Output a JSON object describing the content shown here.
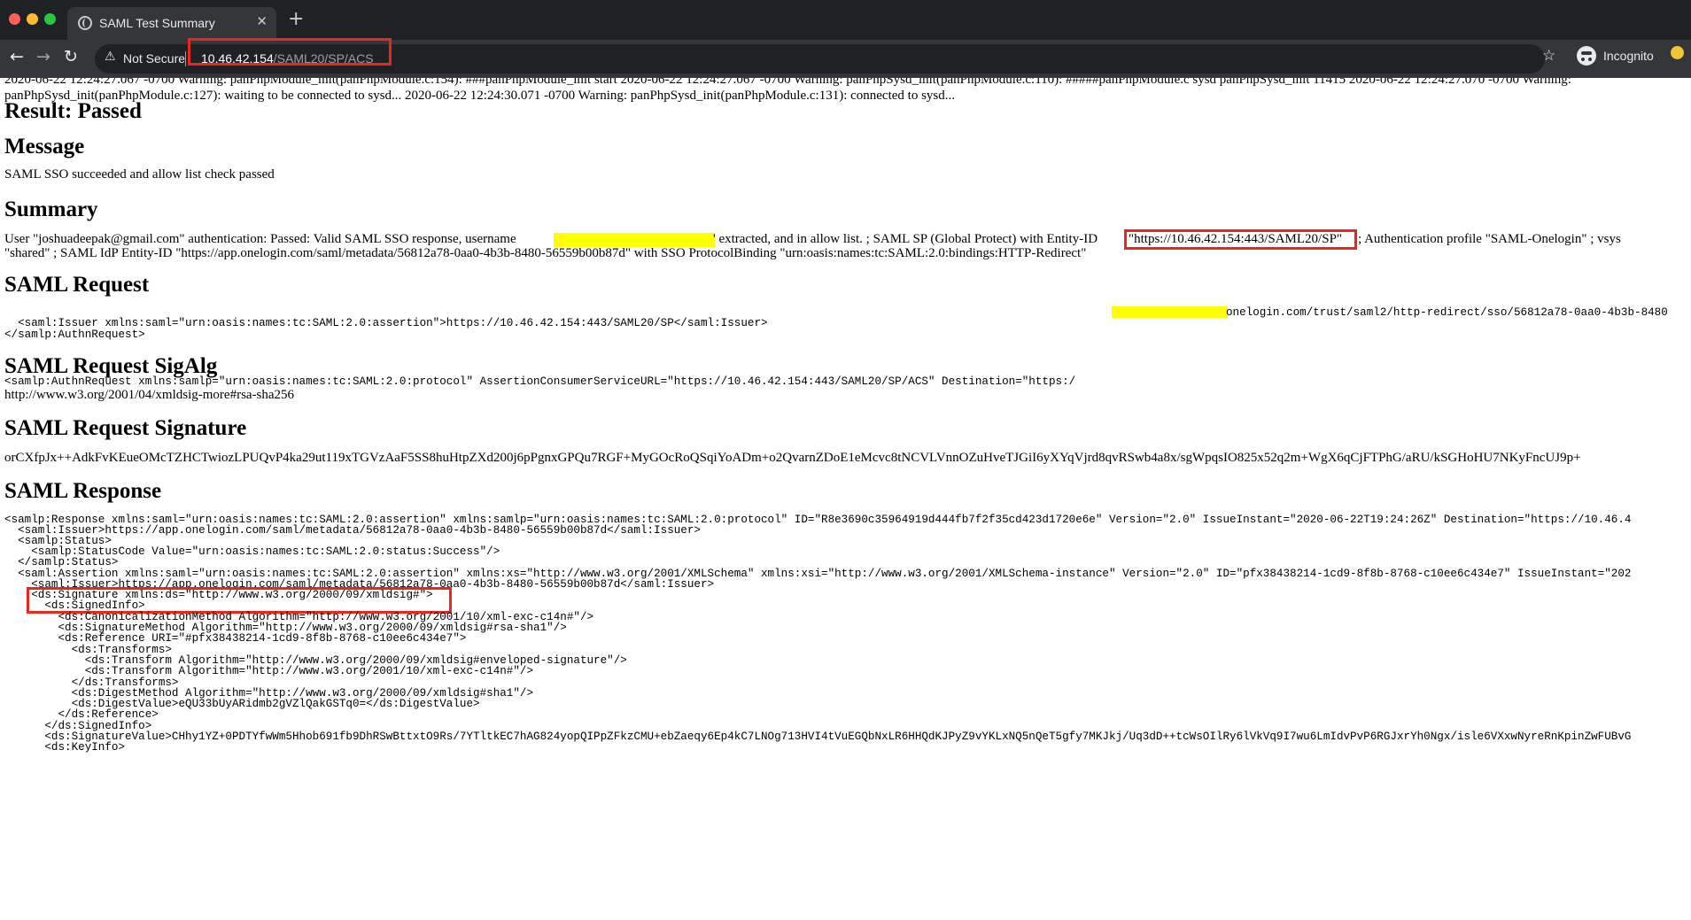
{
  "browser": {
    "tab_title": "SAML Test Summary",
    "tab_close": "✕",
    "new_tab": "+",
    "security_warning": "Not Secure",
    "url_host": "10.46.42.154",
    "url_path": "/SAML20/SP/ACS",
    "incognito_label": "Incognito",
    "icons": [
      "back-arrow-icon",
      "forward-arrow-icon",
      "reload-icon",
      "warning-icon",
      "star-icon",
      "incognito-icon"
    ]
  },
  "page": {
    "log_lines": [
      "2020-06-22 12:24:27.067 -0700 Warning: panPhpModule_init(panPhpModule.c:154): ###panPhpModule_init start 2020-06-22 12:24:27.067 -0700 Warning: panPhpSysd_init(panPhpModule.c:110): #####panPhpModule.c sysd panPhpSysd_init 11415 2020-06-22 12:24:27.070 -0700 Warning:",
      "panPhpSysd_init(panPhpModule.c:127): waiting to be connected to sysd... 2020-06-22 12:24:30.071 -0700 Warning: panPhpSysd_init(panPhpModule.c:131): connected to sysd..."
    ],
    "result_heading": "Result: Passed",
    "message_heading": "Message",
    "message_text": "SAML SSO succeeded and allow list check passed",
    "summary_heading": "Summary",
    "summary_line1_a": "User \"joshuadeepak@gmail.com\" authentication: Passed: Valid SAML SSO response, username",
    "summary_line1_b": "' extracted, and in allow list. ; SAML SP (Global Protect) with Entity-ID",
    "summary_entity_id": "\"https://10.46.42.154:443/SAML20/SP\"",
    "summary_line1_c": "; Authentication profile \"SAML-Onelogin\" ; vsys",
    "summary_line2": "\"shared\" ; SAML IdP Entity-ID \"https://app.onelogin.com/saml/metadata/56812a78-0aa0-4b3b-8480-56559b00b87d\" with SSO ProtocolBinding \"urn:oasis:names:tc:SAML:2.0:bindings:HTTP-Redirect\"",
    "request_heading": "SAML Request",
    "request_line1_a": "<samlp:AuthnRequest xmlns:samlp=\"urn:oasis:names:tc:SAML:2.0:protocol\" AssertionConsumerServiceURL=\"https://10.46.42.154:443/SAML20/SP/ACS\" Destination=\"https:/",
    "request_line1_b": "onelogin.com/trust/saml2/http-redirect/sso/56812a78-0aa0-4b3b-8480",
    "request_line2": "  <saml:Issuer xmlns:saml=\"urn:oasis:names:tc:SAML:2.0:assertion\">https://10.46.42.154:443/SAML20/SP</saml:Issuer>",
    "request_line3": "</samlp:AuthnRequest>",
    "sigalg_heading": "SAML Request SigAlg",
    "sigalg_text": "http://www.w3.org/2001/04/xmldsig-more#rsa-sha256",
    "signature_heading": "SAML Request Signature",
    "signature_text": "orCXfpJx++AdkFvKEueOMcTZHCTwiozLPUQvP4ka29ut119xTGVzAaF5SS8huHtpZXd200j6pPgnxGPQu7RGF+MyGOcRoQSqiYoADm+o2QvarnZDoE1eMcvc8tNCVLVnnOZuHveTJGiI6yXYqVjrd8qvRSwb4a8x/sgWpqsIO825x52q2m+WgX6qCjFTPhG/aRU/kSGHoHU7NKyFncUJ9p+",
    "response_heading": "SAML Response",
    "response_lines": [
      "<samlp:Response xmlns:saml=\"urn:oasis:names:tc:SAML:2.0:assertion\" xmlns:samlp=\"urn:oasis:names:tc:SAML:2.0:protocol\" ID=\"R8e3690c35964919d444fb7f2f35cd423d1720e6e\" Version=\"2.0\" IssueInstant=\"2020-06-22T19:24:26Z\" Destination=\"https://10.46.4",
      "  <saml:Issuer>https://app.onelogin.com/saml/metadata/56812a78-0aa0-4b3b-8480-56559b00b87d</saml:Issuer>",
      "  <samlp:Status>",
      "    <samlp:StatusCode Value=\"urn:oasis:names:tc:SAML:2.0:status:Success\"/>",
      "  </samlp:Status>",
      "  <saml:Assertion xmlns:saml=\"urn:oasis:names:tc:SAML:2.0:assertion\" xmlns:xs=\"http://www.w3.org/2001/XMLSchema\" xmlns:xsi=\"http://www.w3.org/2001/XMLSchema-instance\" Version=\"2.0\" ID=\"pfx38438214-1cd9-8f8b-8768-c10ee6c434e7\" IssueInstant=\"202",
      "    <saml:Issuer>https://app.onelogin.com/saml/metadata/56812a78-0aa0-4b3b-8480-56559b00b87d</saml:Issuer>",
      "    <ds:Signature xmlns:ds=\"http://www.w3.org/2000/09/xmldsig#\">",
      "      <ds:SignedInfo>",
      "        <ds:CanonicalizationMethod Algorithm=\"http://www.w3.org/2001/10/xml-exc-c14n#\"/>",
      "        <ds:SignatureMethod Algorithm=\"http://www.w3.org/2000/09/xmldsig#rsa-sha1\"/>",
      "        <ds:Reference URI=\"#pfx38438214-1cd9-8f8b-8768-c10ee6c434e7\">",
      "          <ds:Transforms>",
      "            <ds:Transform Algorithm=\"http://www.w3.org/2000/09/xmldsig#enveloped-signature\"/>",
      "            <ds:Transform Algorithm=\"http://www.w3.org/2001/10/xml-exc-c14n#\"/>",
      "          </ds:Transforms>",
      "          <ds:DigestMethod Algorithm=\"http://www.w3.org/2000/09/xmldsig#sha1\"/>",
      "          <ds:DigestValue>eQU33bUyARidmb2gVZlQakGSTq0=</ds:DigestValue>",
      "        </ds:Reference>",
      "      </ds:SignedInfo>",
      "      <ds:SignatureValue>CHhy1YZ+0PDTYfwWm5Hhob691fb9DhRSwBttxtO9Rs/7YTltkEC7hAG824yopQIPpZFkzCMU+ebZaeqy6Ep4kC7LNOg713HVI4tVuEGQbNxLR6HHQdKJPyZ9vYKLxNQ5nQeT5gfy7MKJkj/Uq3dD++tcWsOIlRy6lVkVq9I7wu6LmIdvPvP6RGJxrYh0Ngx/isle6VXxwNyreRnKpinZwFUBvG",
      "      <ds:KeyInfo>"
    ]
  }
}
